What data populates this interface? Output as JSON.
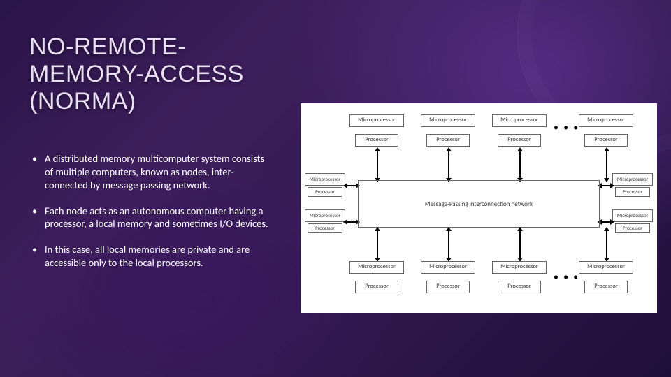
{
  "title": "NO-REMOTE-\nMEMORY-ACCESS\n(NORMA)",
  "bullets": [
    "A distributed memory multicomputer system consists of multiple computers, known as nodes, inter-connected by message passing network.",
    "Each node acts as an autonomous computer having a processor, a local memory and sometimes I/O devices.",
    "In this case, all local memories are private and are accessible only to the local processors."
  ],
  "diagram": {
    "mp": "Microprocessor",
    "proc": "Processor",
    "net": "Message-Passing interconnection network",
    "dots": "• • •"
  }
}
